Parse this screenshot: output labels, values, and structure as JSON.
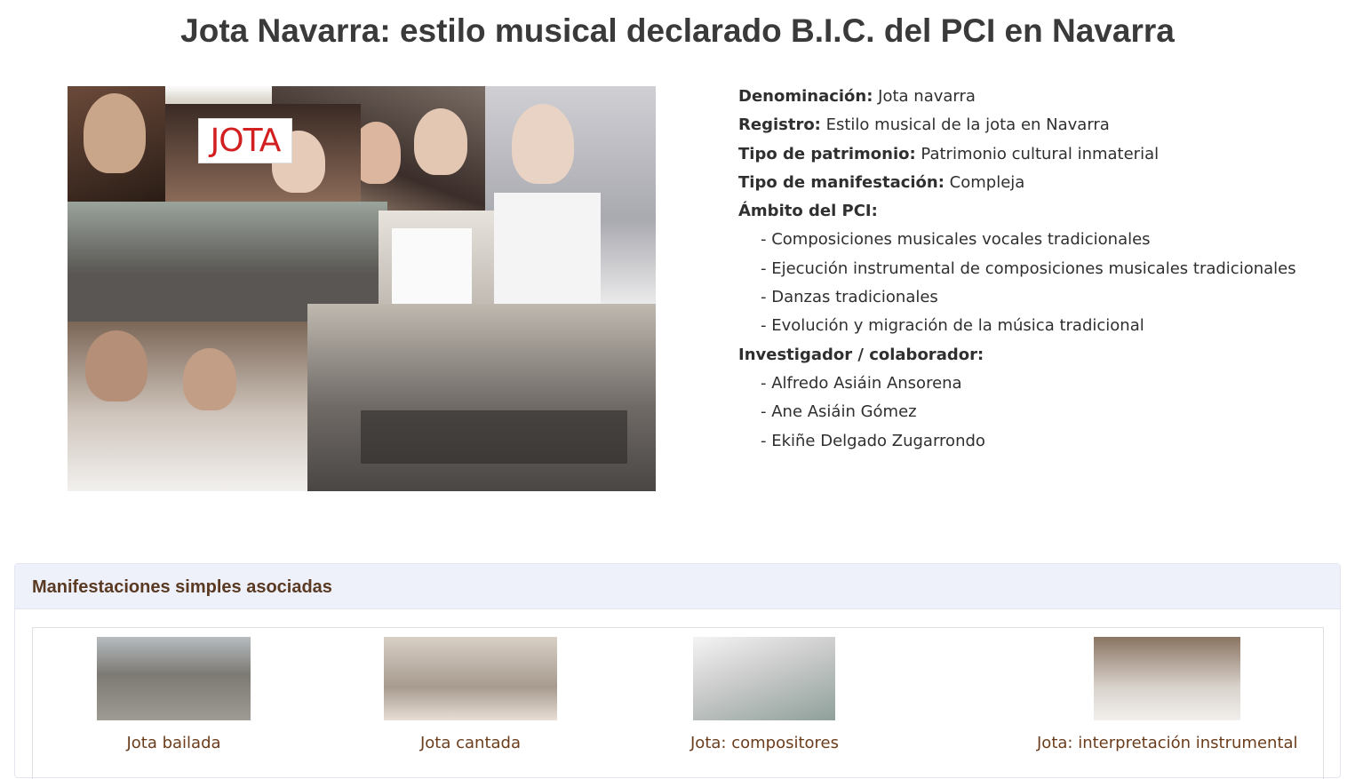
{
  "page": {
    "title": "Jota Navarra: estilo musical declarado B.I.C. del PCI en Navarra"
  },
  "collage": {
    "sign_text": "JOTA"
  },
  "info": {
    "denominacion_label": "Denominación:",
    "denominacion_value": "Jota navarra",
    "registro_label": "Registro:",
    "registro_value": "Estilo musical de la jota en Navarra",
    "tipo_patrimonio_label": "Tipo de patrimonio:",
    "tipo_patrimonio_value": "Patrimonio cultural inmaterial",
    "tipo_manifestacion_label": "Tipo de manifestación:",
    "tipo_manifestacion_value": "Compleja",
    "ambito_label": "Ámbito del PCI:",
    "ambito_items": [
      "- Composiciones musicales vocales tradicionales",
      "- Ejecución instrumental de composiciones musicales tradicionales",
      "- Danzas tradicionales",
      "- Evolución y migración de la música tradicional"
    ],
    "investigador_label": "Investigador / colaborador:",
    "investigador_items": [
      "- Alfredo Asiáin Ansorena",
      "- Ane Asiáin Gómez",
      "- Ekiñe Delgado Zugarrondo"
    ]
  },
  "panel": {
    "heading": "Manifestaciones simples asociadas",
    "cards": [
      {
        "caption": "Jota bailada"
      },
      {
        "caption": "Jota cantada"
      },
      {
        "caption": "Jota: compositores"
      },
      {
        "caption": "Jota: interpretación instrumental"
      }
    ]
  }
}
